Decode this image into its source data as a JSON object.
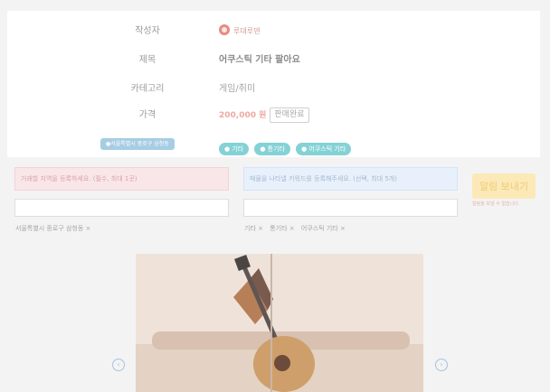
{
  "info": {
    "author_label": "작성자",
    "author_name": "루대루덴",
    "title_label": "제목",
    "title_value": "어쿠스틱 기타 팔아요",
    "category_label": "카테고리",
    "category_value": "게임/취미",
    "price_label": "가격",
    "price_value": "200,000 원",
    "sold_button": "판매완료",
    "location_badge": "●서울특별시 중로구 삼청동",
    "tags": [
      "● 기타",
      "● 통기타",
      "● 어쿠스틱 기타"
    ]
  },
  "form": {
    "region_prompt": "거래할 지역을 등록하세요. (필수, 최대 1곳)",
    "keyword_prompt": "매물을 나타낼 키워드를 등록해주세요. (선택, 최대 5개)",
    "region_input_value": "",
    "keyword_input_value": "",
    "region_chips": [
      "서울특별시 종로구 삼청동 ×"
    ],
    "keyword_chips": [
      "기타 ×",
      "통기타 ×",
      "어쿠스틱 기타 ×"
    ],
    "send_button": "알림 보내기",
    "send_note": "알림을 보낼 수 없습니다."
  },
  "gallery": {
    "prev_icon": "chevron-left-icon",
    "next_icon": "chevron-right-icon",
    "prev_glyph": "‹",
    "next_glyph": "›"
  },
  "colors": {
    "price": "#f0a8a2",
    "tag": "#84d2d6",
    "send_button": "#fbe9b8"
  }
}
